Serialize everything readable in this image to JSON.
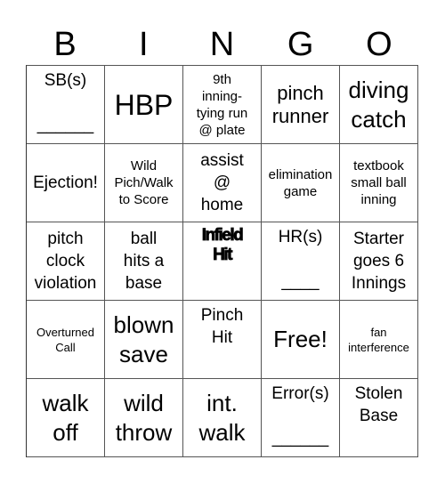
{
  "header": {
    "letters": [
      "B",
      "I",
      "N",
      "G",
      "O"
    ]
  },
  "cells": [
    {
      "text": "SB(s)\n\n______",
      "size": "m",
      "align": "top"
    },
    {
      "text": "HBP",
      "size": "xxl",
      "align": "center"
    },
    {
      "text": "9th\ninning-\ntying run\n@ plate",
      "size": "s",
      "align": "center"
    },
    {
      "text": "pinch\nrunner",
      "size": "l",
      "align": "center"
    },
    {
      "text": "diving\ncatch",
      "size": "xl",
      "align": "center"
    },
    {
      "text": "Ejection!",
      "size": "m",
      "align": "center"
    },
    {
      "text": "Wild\nPich/Walk\nto Score",
      "size": "s",
      "align": "center"
    },
    {
      "text": "assist\n@\nhome",
      "size": "m",
      "align": "center"
    },
    {
      "text": "elimination\ngame",
      "size": "s",
      "align": "center"
    },
    {
      "text": "textbook\nsmall ball\ninning",
      "size": "s",
      "align": "center"
    },
    {
      "text": "pitch\nclock\nviolation",
      "size": "m",
      "align": "center"
    },
    {
      "text": "ball\nhits a\nbase",
      "size": "m",
      "align": "center"
    },
    {
      "text": "Infield\nHit",
      "size": "heavy",
      "align": "top"
    },
    {
      "text": "HR(s)\n\n____",
      "size": "m",
      "align": "top"
    },
    {
      "text": "Starter\ngoes 6\nInnings",
      "size": "m",
      "align": "center"
    },
    {
      "text": "Overturned\nCall",
      "size": "xs",
      "align": "center"
    },
    {
      "text": "blown\nsave",
      "size": "xl",
      "align": "center"
    },
    {
      "text": "Pinch\nHit",
      "size": "m",
      "align": "top"
    },
    {
      "text": "Free!",
      "size": "xl",
      "align": "center"
    },
    {
      "text": "fan\ninterference",
      "size": "xs",
      "align": "center"
    },
    {
      "text": "walk\noff",
      "size": "xl",
      "align": "center"
    },
    {
      "text": "wild\nthrow",
      "size": "xl",
      "align": "center"
    },
    {
      "text": "int.\nwalk",
      "size": "xl",
      "align": "center"
    },
    {
      "text": "Error(s)\n\n______",
      "size": "m",
      "align": "top"
    },
    {
      "text": "Stolen\nBase",
      "size": "m",
      "align": "top"
    }
  ]
}
